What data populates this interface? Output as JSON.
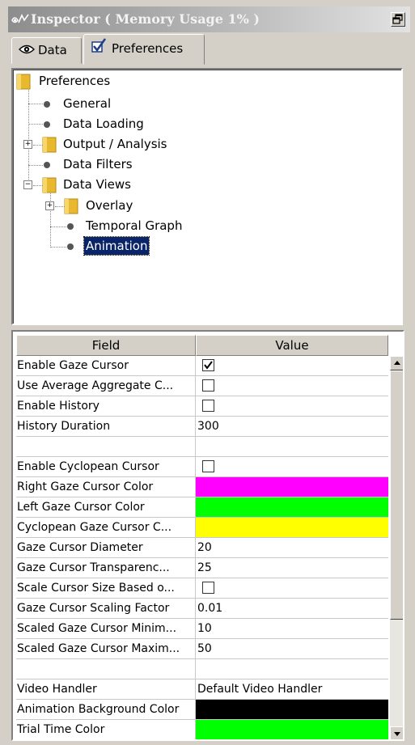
{
  "title": "Inspector ( Memory Usage 1% )",
  "tabs": [
    {
      "label": "Data",
      "icon": "eye-icon",
      "selected": false
    },
    {
      "label": "Preferences",
      "icon": "checkmark-icon",
      "selected": true
    }
  ],
  "tree": {
    "root": "Preferences",
    "items": [
      {
        "label": "General",
        "type": "leaf"
      },
      {
        "label": "Data Loading",
        "type": "leaf"
      },
      {
        "label": "Output / Analysis",
        "type": "folder",
        "expanded": false
      },
      {
        "label": "Data Filters",
        "type": "leaf"
      },
      {
        "label": "Data Views",
        "type": "folder",
        "expanded": true
      },
      {
        "label": "Overlay",
        "type": "folder",
        "expanded": false
      },
      {
        "label": "Temporal Graph",
        "type": "leaf"
      },
      {
        "label": "Animation",
        "type": "leaf",
        "selected": true
      }
    ]
  },
  "properties": {
    "headers": {
      "field": "Field",
      "value": "Value"
    },
    "rows": [
      {
        "field": "Enable Gaze Cursor",
        "kind": "checkbox",
        "checked": true
      },
      {
        "field": "Use Average Aggregate C...",
        "kind": "checkbox",
        "checked": false
      },
      {
        "field": "Enable History",
        "kind": "checkbox",
        "checked": false
      },
      {
        "field": "History Duration",
        "kind": "text",
        "value": "300"
      },
      {
        "field": "",
        "kind": "text",
        "value": ""
      },
      {
        "field": "Enable Cyclopean Cursor",
        "kind": "checkbox",
        "checked": false
      },
      {
        "field": "Right Gaze Cursor Color",
        "kind": "color",
        "color": "#ff00ff"
      },
      {
        "field": "Left Gaze Cursor Color",
        "kind": "color",
        "color": "#00ff00"
      },
      {
        "field": "Cyclopean Gaze Cursor C...",
        "kind": "color",
        "color": "#ffff00"
      },
      {
        "field": "Gaze Cursor Diameter",
        "kind": "text",
        "value": "20"
      },
      {
        "field": "Gaze Cursor Transparenc...",
        "kind": "text",
        "value": "25"
      },
      {
        "field": "Scale Cursor Size Based o...",
        "kind": "checkbox",
        "checked": false
      },
      {
        "field": "Gaze Cursor Scaling Factor",
        "kind": "text",
        "value": "0.01"
      },
      {
        "field": "Scaled Gaze Cursor Minim...",
        "kind": "text",
        "value": "10"
      },
      {
        "field": "Scaled Gaze Cursor Maxim...",
        "kind": "text",
        "value": "50"
      },
      {
        "field": "",
        "kind": "text",
        "value": ""
      },
      {
        "field": "Video Handler",
        "kind": "text",
        "value": "Default Video Handler"
      },
      {
        "field": "Animation Background Color",
        "kind": "color",
        "color": "#000000"
      },
      {
        "field": "Trial Time Color",
        "kind": "color",
        "color": "#00ff00"
      }
    ]
  }
}
